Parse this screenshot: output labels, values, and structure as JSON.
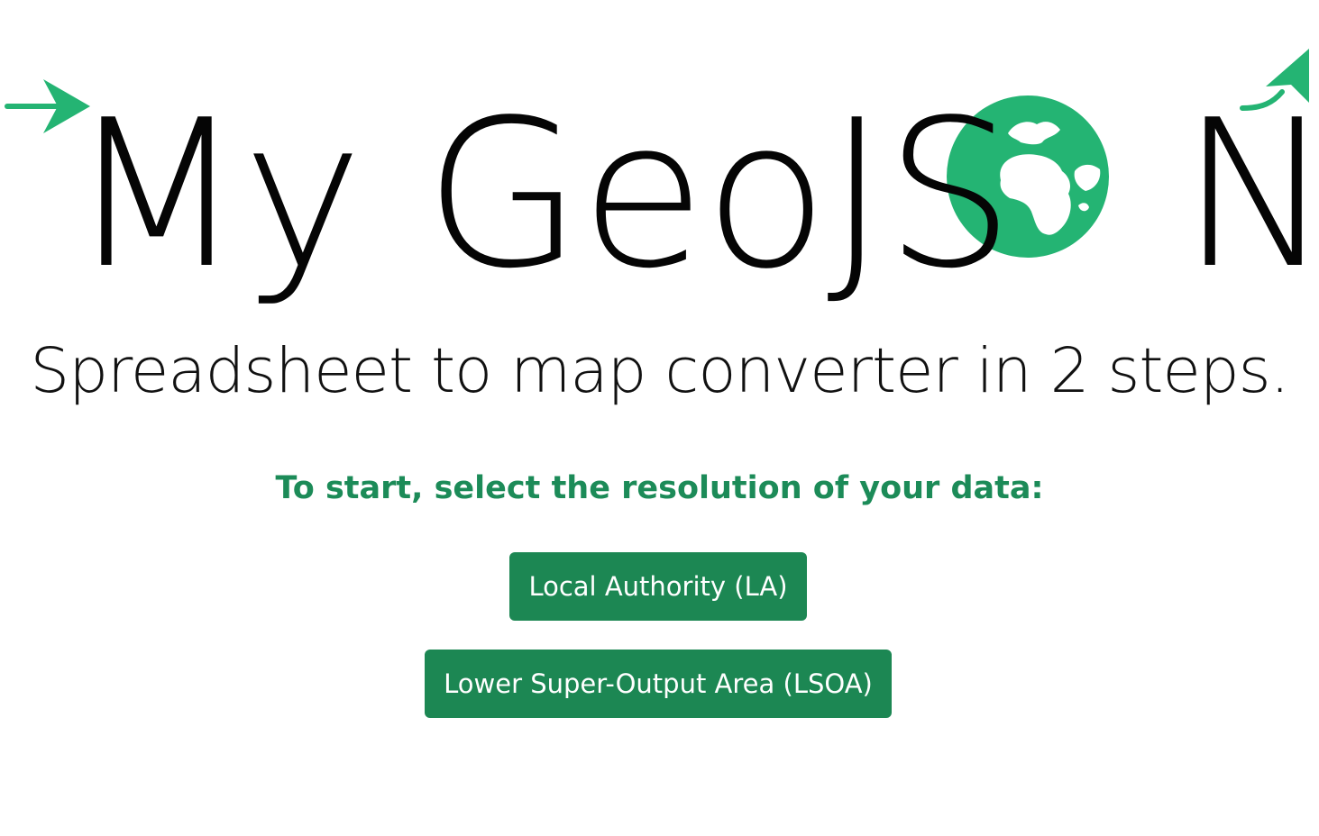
{
  "logo": {
    "text_before_globe": "My GeoJS",
    "text_after_globe": "N",
    "accent_color": "#24b473",
    "left_arrow_icon": "arrow-right",
    "globe_icon": "globe-africa",
    "right_arrow_icon": "curved-arrow-up-right"
  },
  "tagline": "Spreadsheet to map converter in 2 steps.",
  "prompt": "To start, select the resolution of your data:",
  "buttons": {
    "la_label": "Local Authority (LA)",
    "lsoa_label": "Lower Super-Output Area (LSOA)",
    "color": "#1c8753"
  }
}
